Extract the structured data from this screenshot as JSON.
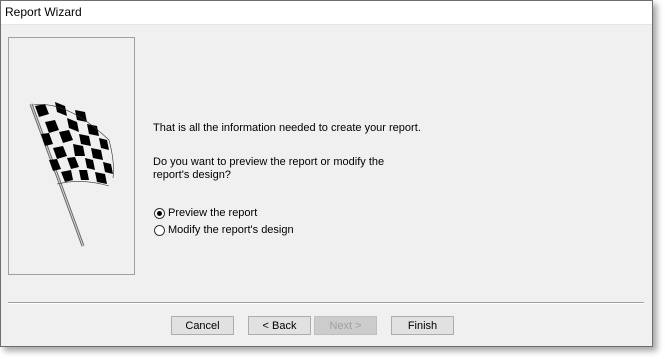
{
  "window": {
    "title": "Report Wizard"
  },
  "content": {
    "intro_text": "That is all the information needed to create your report.",
    "question_text": "Do you want to preview the report or modify the report's design?"
  },
  "options": [
    {
      "label": "Preview the report",
      "checked": true
    },
    {
      "label": "Modify the report's design",
      "checked": false
    }
  ],
  "buttons": {
    "cancel": "Cancel",
    "back": "< Back",
    "next": "Next >",
    "finish": "Finish"
  },
  "icons": {
    "wizard_image": "checkered-flag-icon"
  }
}
